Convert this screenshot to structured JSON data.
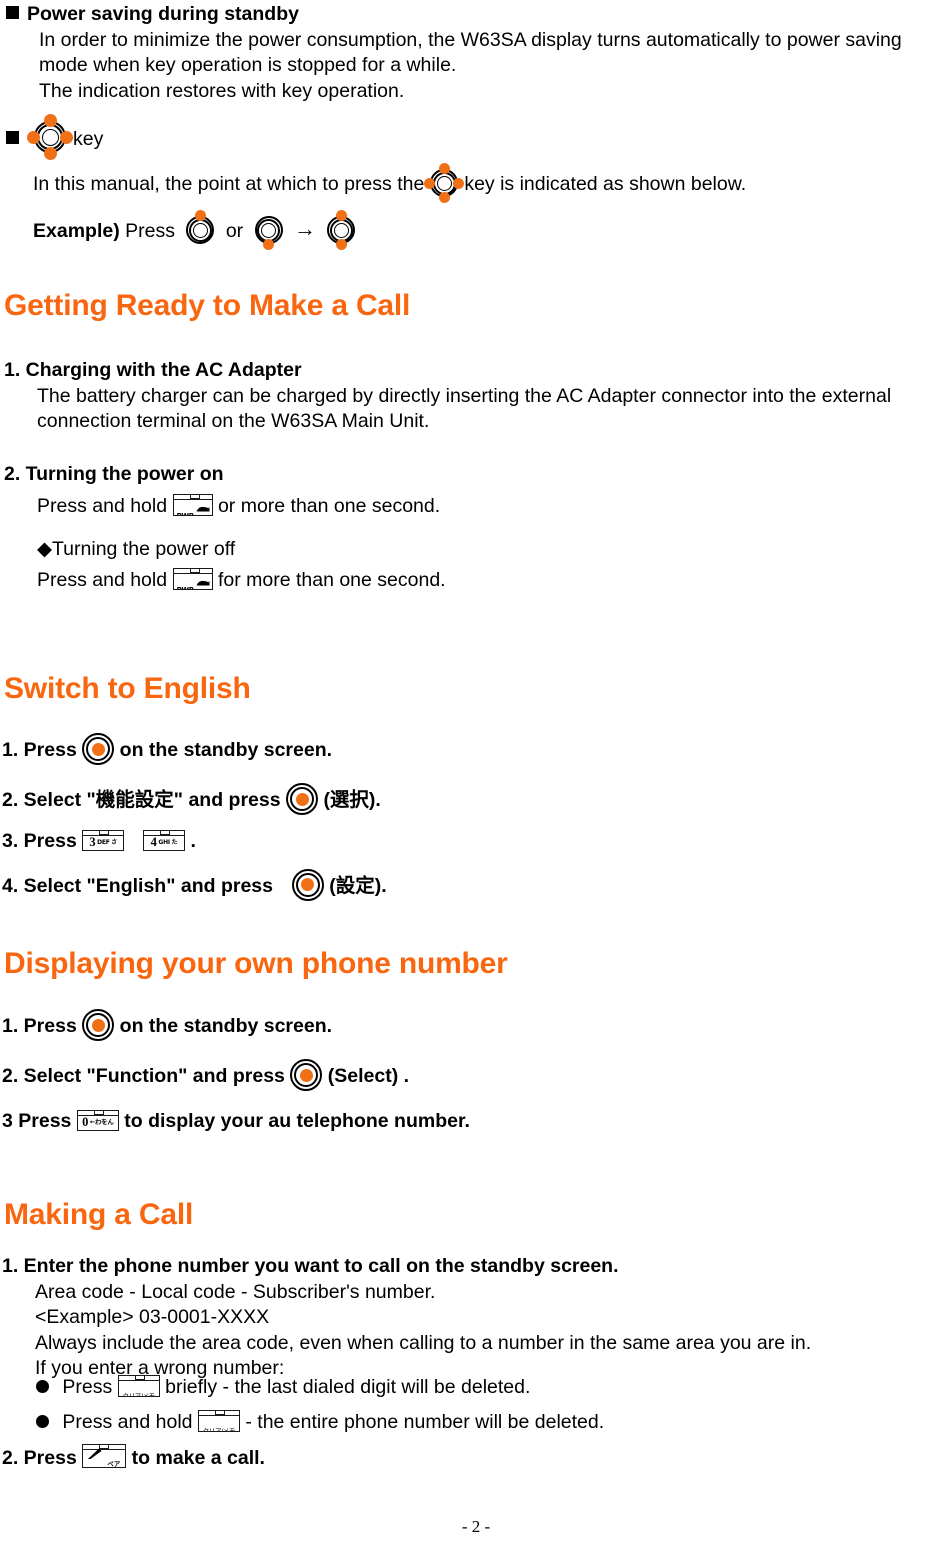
{
  "document": {
    "footer_page_label": "- 2 -",
    "accent_color": "#F96610",
    "key_pip_color": "#F07018"
  },
  "section_power_saving": {
    "heading": "Power saving during standby",
    "line1": "In order to minimize the power consumption, the W63SA display turns automatically to power saving",
    "line2": "mode when key operation is stopped for a while.",
    "line3": "The indication restores with key operation."
  },
  "section_nav_key": {
    "heading_suffix": "key",
    "manual_text_before": "In this manual, the point at which to press the",
    "manual_text_after": "key is indicated as shown below.",
    "example_label": "Example)",
    "example_press": "Press",
    "example_or": "or",
    "example_arrow": "→"
  },
  "section_getting_ready": {
    "heading": "Getting Ready to Make a Call",
    "step1": {
      "title": "1. Charging with the AC Adapter",
      "line1": "The battery charger can be charged by directly inserting the AC Adapter connector into the external",
      "line2": "connection terminal on the W63SA Main Unit."
    },
    "step2": {
      "title": "2. Turning the power on",
      "press_before": "Press and hold",
      "press_after": "or more than one second.",
      "power_off_title": "◆Turning the power off",
      "off_before": "Press and hold",
      "off_after": "for more than one second."
    }
  },
  "section_switch_english": {
    "heading": "Switch to English",
    "step1_before": "1. Press",
    "step1_after": "on the standby screen.",
    "step2_before": "2. Select \"機能設定\" and press",
    "step2_after": "(選択).",
    "step3_before": "3. Press",
    "step3_after": ".",
    "step4_before": "4. Select \"English\" and press",
    "step4_after": "(設定)."
  },
  "section_own_number": {
    "heading": "Displaying your own phone number",
    "step1_before": "1. Press",
    "step1_after": "on the standby screen.",
    "step2_before": "2. Select \"Function\" and press",
    "step2_after": "(Select) .",
    "step3_before": "3 Press",
    "step3_after": "to display your au telephone number."
  },
  "section_making_call": {
    "heading": "Making a Call",
    "step1_title": "1. Enter the phone number you want to call on the standby screen.",
    "step1_l1": "Area code - Local code - Subscriber's number.",
    "step1_l2": "<Example> 03-0001-XXXX",
    "step1_l3": "Always include the area code, even when calling to a number in the same area you are in.",
    "step1_l4": "If you enter a wrong number:",
    "bullet1_before": "Press",
    "bullet1_after": "briefly - the last dialed digit will be deleted.",
    "bullet2_before": "Press and hold",
    "bullet2_after": "- the entire phone number will be deleted.",
    "step2_before": "2. Press",
    "step2_after": "to make a call."
  },
  "keys": {
    "pwr": {
      "label": "PWR",
      "name": "power-key"
    },
    "key3": {
      "num": "3",
      "latin": "DEF",
      "kana": "さ"
    },
    "key4": {
      "num": "4",
      "latin": "GHI",
      "kana": "た"
    },
    "key0": {
      "num": "0",
      "kana": "←わをん"
    },
    "clear": {
      "label": "クリア/メモ"
    },
    "call": {
      "label": "ペア"
    }
  }
}
